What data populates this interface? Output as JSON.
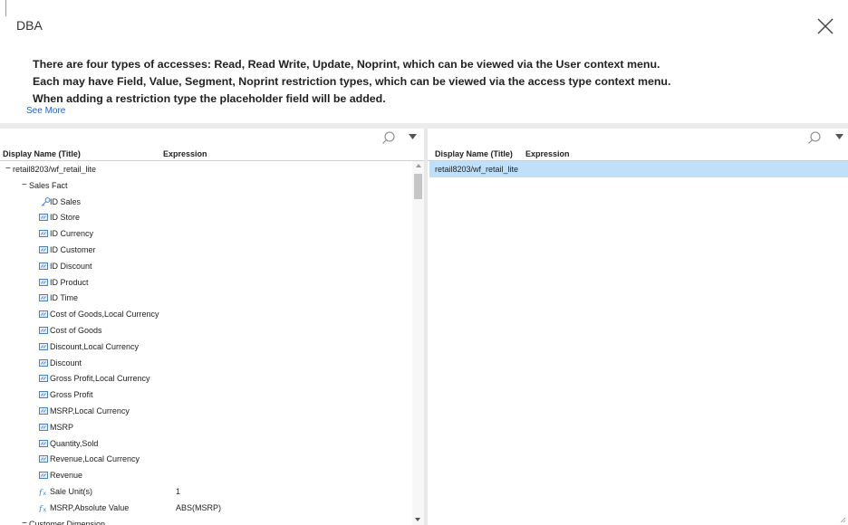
{
  "dialog": {
    "title": "DBA",
    "description": [
      "There are four types of accesses: Read, Read Write, Update, Noprint, which can be viewed via the User context menu.",
      "Each may have Field, Value, Segment, Noprint restriction types, which can be viewed via the access type context menu.",
      "When adding a restriction type the placeholder field will be added."
    ],
    "see_more": "See More"
  },
  "left_panel": {
    "columns": {
      "name": "Display Name (Title)",
      "expression": "Expression"
    },
    "rows": [
      {
        "toggle": "−",
        "label": "retail8203/wf_retail_lite",
        "expr": ""
      },
      {
        "toggle": "−",
        "label": "Sales Fact",
        "expr": ""
      },
      {
        "icon": "key",
        "label": "ID Sales",
        "expr": ""
      },
      {
        "icon": "measure",
        "label": "ID Store",
        "expr": ""
      },
      {
        "icon": "measure",
        "label": "ID Currency",
        "expr": ""
      },
      {
        "icon": "measure",
        "label": "ID Customer",
        "expr": ""
      },
      {
        "icon": "measure",
        "label": "ID Discount",
        "expr": ""
      },
      {
        "icon": "measure",
        "label": "ID Product",
        "expr": ""
      },
      {
        "icon": "measure",
        "label": "ID Time",
        "expr": ""
      },
      {
        "icon": "measure",
        "label": "Cost of Goods,Local Currency",
        "expr": ""
      },
      {
        "icon": "measure",
        "label": "Cost of Goods",
        "expr": ""
      },
      {
        "icon": "measure",
        "label": "Discount,Local Currency",
        "expr": ""
      },
      {
        "icon": "measure",
        "label": "Discount",
        "expr": ""
      },
      {
        "icon": "measure",
        "label": "Gross Profit,Local Currency",
        "expr": ""
      },
      {
        "icon": "measure",
        "label": "Gross Profit",
        "expr": ""
      },
      {
        "icon": "measure",
        "label": "MSRP,Local Currency",
        "expr": ""
      },
      {
        "icon": "measure",
        "label": "MSRP",
        "expr": ""
      },
      {
        "icon": "measure",
        "label": "Quantity,Sold",
        "expr": ""
      },
      {
        "icon": "measure",
        "label": "Revenue,Local Currency",
        "expr": ""
      },
      {
        "icon": "measure",
        "label": "Revenue",
        "expr": ""
      },
      {
        "icon": "fx",
        "label": "Sale Unit(s)",
        "expr": "1"
      },
      {
        "icon": "fx",
        "label": "MSRP,Absolute Value",
        "expr": "ABS(MSRP)"
      },
      {
        "toggle": "−",
        "label": "Customer Dimension",
        "expr": ""
      }
    ]
  },
  "right_panel": {
    "columns": {
      "name": "Display Name (Title)",
      "expression": "Expression"
    },
    "rows": [
      {
        "label": "retail8203/wf_retail_lite"
      }
    ]
  },
  "colors": {
    "accent_link": "#1f5fc6",
    "selection": "#bfe0f8",
    "icon_blue": "#4a7fc1"
  }
}
